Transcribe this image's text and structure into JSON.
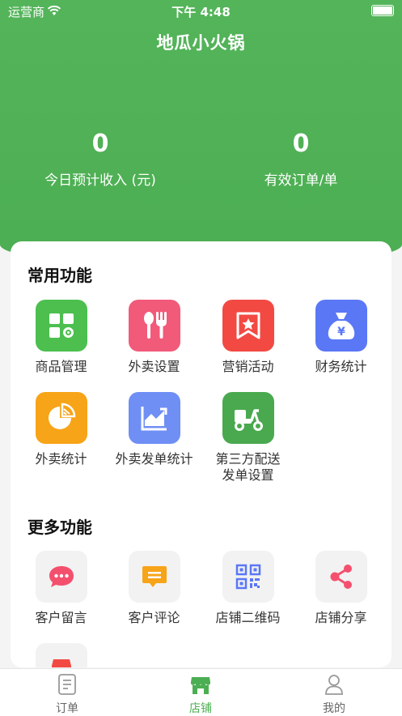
{
  "status_bar": {
    "carrier": "运营商",
    "time": "下午 4:48"
  },
  "header": {
    "title": "地瓜小火锅",
    "stats": [
      {
        "value": "0",
        "label": "今日预计收入 (元)"
      },
      {
        "value": "0",
        "label": "有效订单/单"
      }
    ]
  },
  "common": {
    "title": "常用功能",
    "items": [
      {
        "label": "商品管理",
        "icon": "grid-gear-icon",
        "color": "#4cbf4f"
      },
      {
        "label": "外卖设置",
        "icon": "fork-spoon-icon",
        "color": "#f25a7a"
      },
      {
        "label": "营销活动",
        "icon": "star-badge-icon",
        "color": "#f24a43"
      },
      {
        "label": "财务统计",
        "icon": "money-bag-icon",
        "color": "#5a77f5"
      },
      {
        "label": "外卖统计",
        "icon": "pie-chart-icon",
        "color": "#f7a418"
      },
      {
        "label": "外卖发单统计",
        "icon": "trend-chart-icon",
        "color": "#6f8ff5"
      },
      {
        "label": "第三方配送\n发单设置",
        "icon": "scooter-icon",
        "color": "#4aa94f"
      }
    ]
  },
  "more": {
    "title": "更多功能",
    "items": [
      {
        "label": "客户留言",
        "icon": "chat-bubble-icon",
        "color": "#f4506e"
      },
      {
        "label": "客户评论",
        "icon": "comment-icon",
        "color": "#f7a418"
      },
      {
        "label": "店铺二维码",
        "icon": "qr-code-icon",
        "color": "#5a77f5"
      },
      {
        "label": "店铺分享",
        "icon": "share-icon",
        "color": "#f4506e"
      }
    ]
  },
  "tabbar": {
    "tabs": [
      {
        "label": "订单",
        "icon": "document-icon"
      },
      {
        "label": "店铺",
        "icon": "store-icon",
        "active": true
      },
      {
        "label": "我的",
        "icon": "person-icon"
      }
    ]
  }
}
